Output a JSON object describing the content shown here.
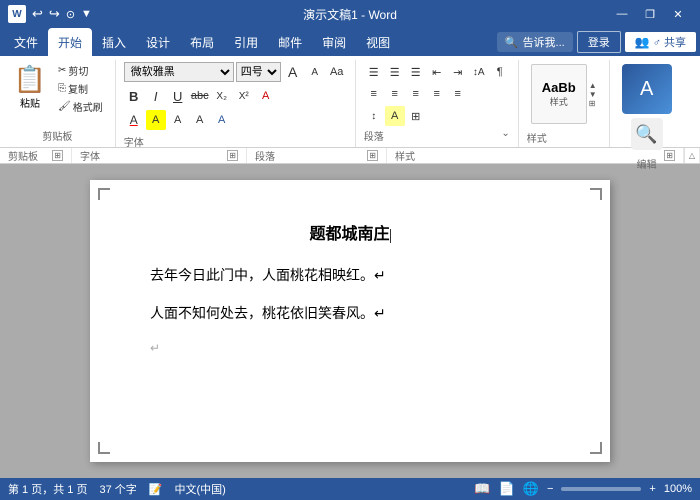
{
  "titleBar": {
    "title": "演示文稿1 - Word",
    "logoText": "W",
    "undoLabel": "↩",
    "redoLabel": "↪",
    "autosaveLabel": "⊙",
    "winBtns": [
      "—",
      "❐",
      "✕"
    ]
  },
  "menuBar": {
    "items": [
      "文件",
      "开始",
      "插入",
      "设计",
      "布局",
      "引用",
      "邮件",
      "审阅",
      "视图"
    ],
    "activeItem": "开始",
    "searchPlaceholder": "♪ 告诉我...",
    "signIn": "登录",
    "share": "♂ 共享"
  },
  "ribbon": {
    "groups": [
      {
        "name": "剪贴板",
        "label": "剪贴板",
        "pasteBtn": "粘贴",
        "smallBtns": [
          "剪切",
          "复制",
          "格式刷"
        ]
      },
      {
        "name": "字体",
        "label": "字体",
        "fontName": "微软雅黑",
        "fontSize": "四号",
        "formatBtns": [
          "B",
          "I",
          "U",
          "abc",
          "X₂",
          "X²"
        ],
        "colorBtns": [
          "A",
          "A",
          "Aa",
          "A",
          "A"
        ]
      },
      {
        "name": "段落",
        "label": "段落",
        "alignBtns": [
          "≡",
          "≡",
          "≡",
          "≡",
          "≡"
        ],
        "indentBtns": [
          "⇤",
          "⇥"
        ],
        "listBtns": [
          "☰",
          "☰",
          "☰"
        ],
        "sortBtn": "⇅",
        "borderBtn": "⊞"
      },
      {
        "name": "样式",
        "label": "样式",
        "styleLabel": "样式"
      },
      {
        "name": "编辑",
        "label": "编辑",
        "searchBtn": "🔍",
        "editLabel": "编辑"
      }
    ],
    "labels": {
      "clipboard": "剪贴板",
      "font": "字体",
      "paragraph": "段落",
      "style": "样式",
      "edit": "编辑"
    }
  },
  "document": {
    "title": "题都城南庄",
    "paragraphs": [
      "去年今日此门中，人面桃花相映红。↵",
      "人面不知何处去，桃花依旧笑春风。↵"
    ],
    "enterMark": "↵"
  },
  "statusBar": {
    "pageInfo": "第 1 页，共 1 页",
    "wordCount": "37 个字",
    "language": "中文(中国)",
    "zoom": "100%"
  }
}
